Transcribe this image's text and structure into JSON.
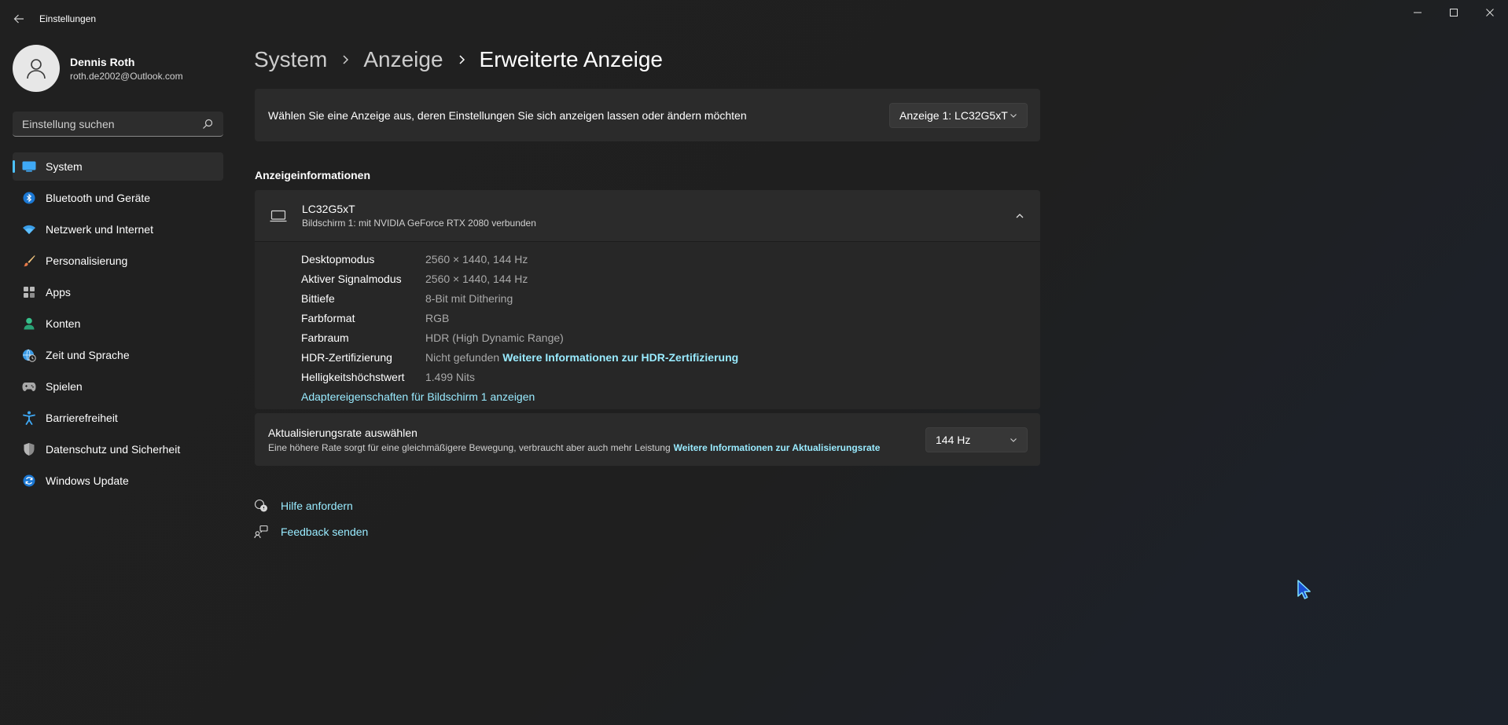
{
  "window": {
    "title": "Einstellungen"
  },
  "profile": {
    "name": "Dennis Roth",
    "email": "roth.de2002@Outlook.com"
  },
  "search": {
    "placeholder": "Einstellung suchen"
  },
  "sidebar": {
    "items": [
      {
        "label": "System",
        "icon": "monitor-icon",
        "active": true
      },
      {
        "label": "Bluetooth und Geräte",
        "icon": "bluetooth-icon"
      },
      {
        "label": "Netzwerk und Internet",
        "icon": "wifi-icon"
      },
      {
        "label": "Personalisierung",
        "icon": "brush-icon"
      },
      {
        "label": "Apps",
        "icon": "apps-icon"
      },
      {
        "label": "Konten",
        "icon": "person-icon"
      },
      {
        "label": "Zeit und Sprache",
        "icon": "globe-clock-icon"
      },
      {
        "label": "Spielen",
        "icon": "gamepad-icon"
      },
      {
        "label": "Barrierefreiheit",
        "icon": "accessibility-icon"
      },
      {
        "label": "Datenschutz und Sicherheit",
        "icon": "shield-icon"
      },
      {
        "label": "Windows Update",
        "icon": "update-icon"
      }
    ]
  },
  "breadcrumb": {
    "items": [
      "System",
      "Anzeige",
      "Erweiterte Anzeige"
    ]
  },
  "display_select": {
    "text": "Wählen Sie eine Anzeige aus, deren Einstellungen Sie sich anzeigen lassen oder ändern möchten",
    "value": "Anzeige 1: LC32G5xT"
  },
  "info_section": {
    "title": "Anzeigeinformationen",
    "monitor_name": "LC32G5xT",
    "monitor_sub": "Bildschirm 1: mit NVIDIA GeForce RTX 2080 verbunden",
    "rows": [
      {
        "key": "Desktopmodus",
        "value": "2560 × 1440, 144 Hz"
      },
      {
        "key": "Aktiver Signalmodus",
        "value": "2560 × 1440, 144 Hz"
      },
      {
        "key": "Bittiefe",
        "value": "8-Bit mit Dithering"
      },
      {
        "key": "Farbformat",
        "value": "RGB"
      },
      {
        "key": "Farbraum",
        "value": "HDR (High Dynamic Range)"
      },
      {
        "key": "HDR-Zertifizierung",
        "value": "Nicht gefunden",
        "link": "Weitere Informationen zur HDR-Zertifizierung"
      },
      {
        "key": "Helligkeitshöchstwert",
        "value": "1.499 Nits"
      }
    ],
    "adapter_link": "Adaptereigenschaften für Bildschirm 1 anzeigen"
  },
  "refresh_rate": {
    "title": "Aktualisierungsrate auswählen",
    "description": "Eine höhere Rate sorgt für eine gleichmäßigere Bewegung, verbraucht aber auch mehr Leistung",
    "link": "Weitere Informationen zur Aktualisierungsrate",
    "value": "144 Hz"
  },
  "help": {
    "get_help": "Hilfe anfordern",
    "feedback": "Feedback senden"
  },
  "colors": {
    "accent": "#4cc2ff",
    "link": "#99ebff"
  }
}
